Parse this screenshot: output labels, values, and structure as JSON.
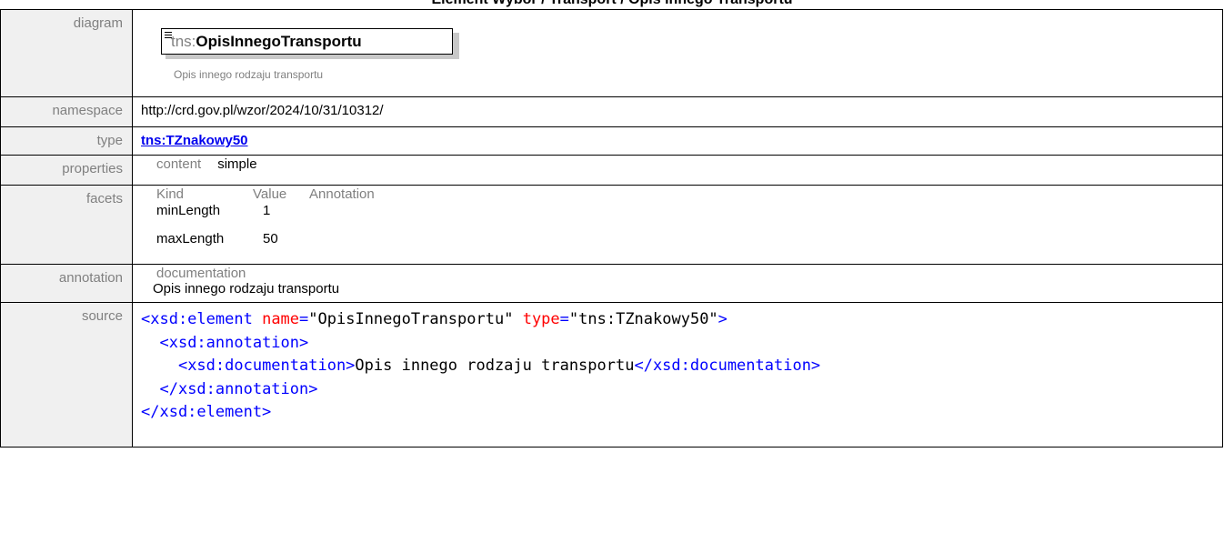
{
  "page_title": "Element Wybor / Transport / Opis innego Transportu",
  "diagram": {
    "label": "diagram",
    "element_prefix": "tns:",
    "element_name": "OpisInnegoTransportu",
    "description": "Opis innego rodzaju transportu"
  },
  "namespace": {
    "label": "namespace",
    "value": "http://crd.gov.pl/wzor/2024/10/31/10312/"
  },
  "type": {
    "label": "type",
    "value": "tns:TZnakowy50"
  },
  "properties": {
    "label": "properties",
    "key": "content",
    "value": "simple"
  },
  "facets": {
    "label": "facets",
    "headers": [
      "Kind",
      "Value",
      "Annotation"
    ],
    "rows": [
      {
        "kind": "minLength",
        "value": "1"
      },
      {
        "kind": "maxLength",
        "value": "50"
      }
    ]
  },
  "annotation": {
    "label": "annotation",
    "key": "documentation",
    "value": "Opis innego rodzaju transportu"
  },
  "source": {
    "label": "source",
    "l1_open": "<xsd:element",
    "l1_attr1": "name",
    "l1_eq": "=",
    "l1_val1": "\"OpisInnegoTransportu\"",
    "l1_attr2": "type",
    "l1_val2": "\"tns:TZnakowy50\"",
    "l1_close": ">",
    "l2": "<xsd:annotation>",
    "l3_open": "<xsd:documentation>",
    "l3_text": "Opis innego rodzaju transportu",
    "l3_close": "</xsd:documentation>",
    "l4": "</xsd:annotation>",
    "l5": "</xsd:element>"
  }
}
